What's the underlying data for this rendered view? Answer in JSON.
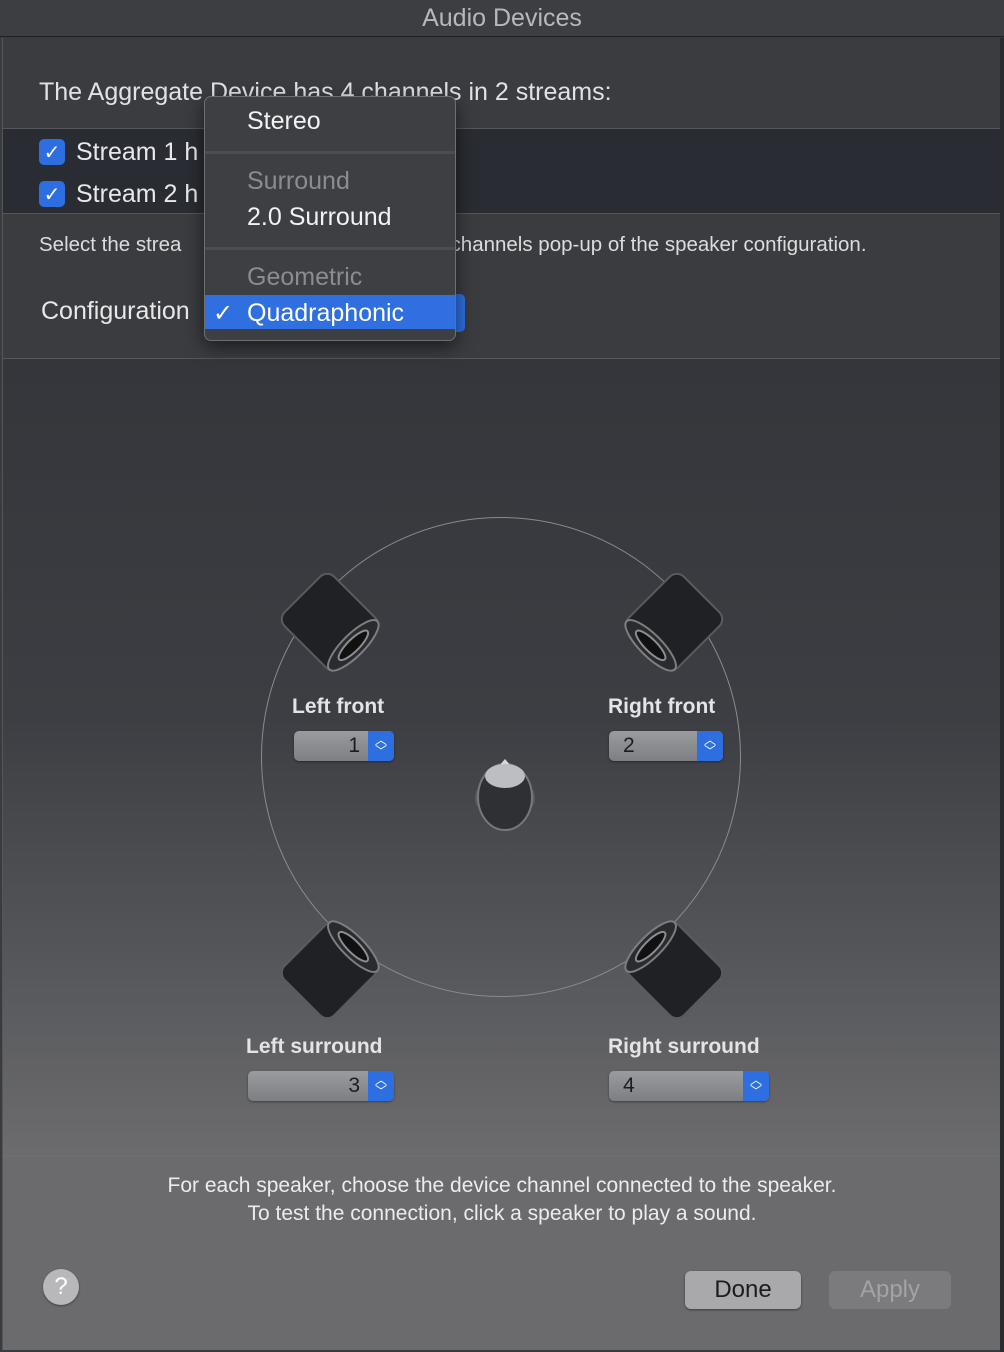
{
  "window": {
    "title": "Audio Devices"
  },
  "heading": "The Aggregate Device has 4 channels in 2 streams:",
  "streams": [
    {
      "label": "Stream 1 h",
      "checked": true
    },
    {
      "label": "Stream 2 h",
      "checked": true
    }
  ],
  "instruction": {
    "left": "Select the strea",
    "right": "e channels pop-up of the speaker configuration."
  },
  "configuration": {
    "label": "Configuration",
    "selected": "Quadraphonic"
  },
  "menu": {
    "items": [
      {
        "label": "Stereo",
        "kind": "item"
      },
      {
        "label": "Surround",
        "kind": "header"
      },
      {
        "label": "2.0 Surround",
        "kind": "item"
      },
      {
        "label": "Geometric",
        "kind": "header"
      },
      {
        "label": "Quadraphonic",
        "kind": "item",
        "checked": true
      }
    ],
    "check_glyph": "✓"
  },
  "speakers": {
    "left_front": {
      "label": "Left front",
      "channel": "1"
    },
    "right_front": {
      "label": "Right front",
      "channel": "2"
    },
    "left_surround": {
      "label": "Left surround",
      "channel": "3"
    },
    "right_surround": {
      "label": "Right surround",
      "channel": "4"
    }
  },
  "hint": {
    "line1": "For each speaker, choose the device channel connected to the speaker.",
    "line2": "To test the connection, click a speaker to play a sound."
  },
  "buttons": {
    "help": "?",
    "done": "Done",
    "apply": "Apply"
  },
  "colors": {
    "accent": "#2f6fe0",
    "window_bg": "#3b3c40",
    "menu_bg": "#3e3f43"
  },
  "icons": {
    "checkbox": "checkmark-icon",
    "stepper": "up-down-chevron-icon",
    "speaker": "speaker-icon",
    "listener": "listener-head-icon"
  }
}
